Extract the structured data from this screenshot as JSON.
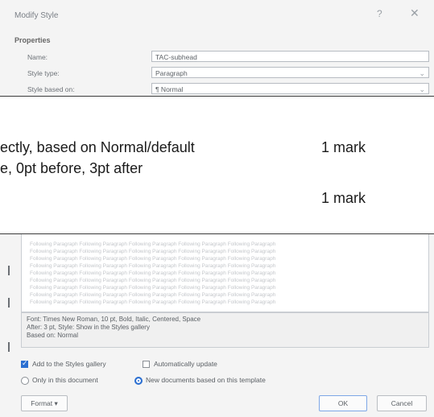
{
  "dialog": {
    "title": "Modify Style",
    "help": "?",
    "close": "✕",
    "properties_heading": "Properties",
    "fields": [
      {
        "label": "Name:",
        "value": "TAC-subhead"
      },
      {
        "label": "Style type:",
        "value": "Paragraph"
      },
      {
        "label": "Style based on:",
        "value": "¶ Normal"
      }
    ]
  },
  "overlay": {
    "line1": "ectly, based on Normal/default",
    "mark1": "1 mark",
    "line2": "e, 0pt before, 3pt after",
    "mark2": "1 mark"
  },
  "preview": {
    "heading": "",
    "sample_line": "Following Paragraph Following Paragraph Following Paragraph Following Paragraph Following Paragraph"
  },
  "description": {
    "line1": "Font: Times New Roman, 10 pt, Bold, Italic, Centered, Space",
    "line2": "After: 3 pt, Style: Show in the Styles gallery",
    "line3": "Based on: Normal"
  },
  "options": {
    "add_to_gallery": "Add to the Styles gallery",
    "auto_update": "Automatically update",
    "only_this_doc": "Only in this document",
    "new_docs": "New documents based on this template"
  },
  "buttons": {
    "format": "Format ▾",
    "ok": "OK",
    "cancel": "Cancel"
  }
}
